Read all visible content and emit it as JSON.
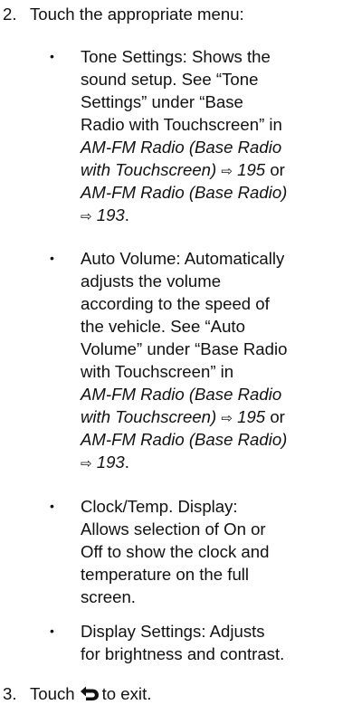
{
  "steps": [
    {
      "num": "2.",
      "text": "Touch the appropriate menu:"
    },
    {
      "num": "3.",
      "text_before": "Touch",
      "text_after": "to exit."
    }
  ],
  "bullet_symbol": "•",
  "arrow_symbol": "⇨",
  "bullets": {
    "tone": {
      "l1": "Tone Settings: Shows the",
      "l2": "sound setup. See “Tone",
      "l3": "Settings” under “Base",
      "l4": "Radio with Touchscreen” in",
      "l5a": "AM-FM Radio (Base Radio",
      "l6a": "with Touchscreen)",
      "l6p": "195",
      "l6c": "or",
      "l7a": "AM-FM Radio (Base Radio)",
      "l8p": "193",
      "l8c": "."
    },
    "auto": {
      "l1": "Auto Volume: Automatically",
      "l2": "adjusts the volume",
      "l3": "according to the speed of",
      "l4": "the vehicle. See “Auto",
      "l5": "Volume” under “Base Radio",
      "l6": "with Touchscreen” in",
      "l7a": "AM-FM Radio (Base Radio",
      "l8a": "with Touchscreen)",
      "l8p": "195",
      "l8c": "or",
      "l9a": "AM-FM Radio (Base Radio)",
      "l10p": "193",
      "l10c": "."
    },
    "clock": {
      "l1": "Clock/Temp. Display:",
      "l2": "Allows selection of On or",
      "l3": "Off to show the clock and",
      "l4": "temperature on the full",
      "l5": "screen."
    },
    "display": {
      "l1": "Display Settings: Adjusts",
      "l2": "for brightness and contrast."
    }
  }
}
